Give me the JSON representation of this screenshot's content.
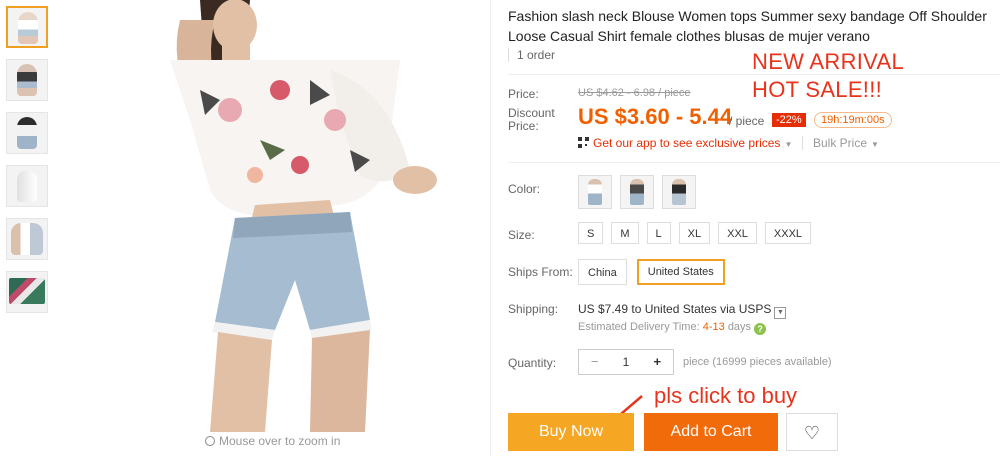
{
  "gallery": {
    "thumbnails": [
      "thumb-1",
      "thumb-2",
      "thumb-3",
      "thumb-4",
      "thumb-5",
      "thumb-6"
    ],
    "zoom_hint": "Mouse over to zoom in"
  },
  "product": {
    "title": "Fashion slash neck Blouse Women tops Summer sexy bandage Off Shoulder Loose Casual Shirt female clothes blusas de mujer verano",
    "orders": "1 order"
  },
  "promo": {
    "line1": "NEW ARRIVAL",
    "line2": "HOT SALE!!!",
    "click_note": "pls click to buy"
  },
  "pricing": {
    "price_label": "Price:",
    "original_price": "US $4.62 - 6.98 / piece",
    "discount_label": "Discount Price:",
    "discount_price": "US $3.60 - 5.44",
    "unit": "/ piece",
    "discount_badge": "-22%",
    "countdown": "19h:19m:00s",
    "app_link": "Get our app to see exclusive prices",
    "bulk_price": "Bulk Price"
  },
  "options": {
    "color_label": "Color:",
    "size_label": "Size:",
    "sizes": [
      "S",
      "M",
      "L",
      "XL",
      "XXL",
      "XXXL"
    ],
    "ships_from_label": "Ships From:",
    "ships_from": [
      "China",
      "United States"
    ],
    "ships_from_selected": "United States"
  },
  "shipping": {
    "label": "Shipping:",
    "text": "US $7.49 to United States via USPS",
    "eta_prefix": "Estimated Delivery Time:",
    "eta_days": "4-13",
    "eta_suffix": "days"
  },
  "quantity": {
    "label": "Quantity:",
    "value": "1",
    "minus": "−",
    "plus": "+",
    "available": "piece (16999 pieces available)"
  },
  "actions": {
    "buy_now": "Buy Now",
    "add_to_cart": "Add to Cart",
    "wishlist_icon": "heart-icon"
  },
  "colors": {
    "accent_orange": "#f06000",
    "buy_button": "#f5a623",
    "cart_button": "#f26b0b",
    "promo_red": "#e8331c",
    "selected_border": "#f0a020"
  }
}
